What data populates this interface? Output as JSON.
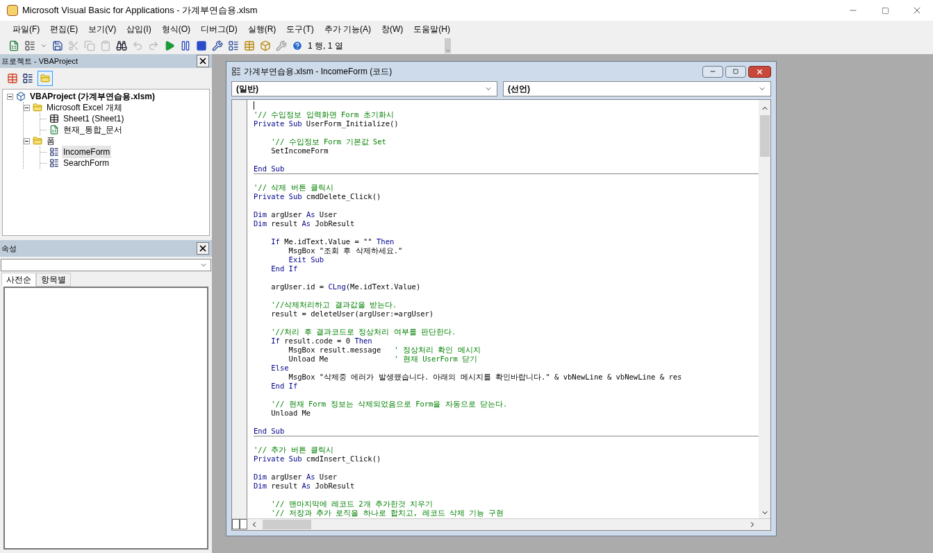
{
  "window": {
    "title": "Microsoft Visual Basic for Applications - 가계부연습용.xlsm"
  },
  "menu": [
    "파일(F)",
    "편집(E)",
    "보기(V)",
    "삽입(I)",
    "형식(O)",
    "디버그(D)",
    "실행(R)",
    "도구(T)",
    "추가 기능(A)",
    "창(W)",
    "도움말(H)"
  ],
  "toolbar": {
    "position": "1 행, 1 열"
  },
  "project_pane": {
    "title": "프로젝트 - VBAProject",
    "tree": [
      {
        "label": "VBAProject (가계부연습용.xlsm)",
        "kind": "project",
        "expanded": true,
        "selected": false,
        "children": [
          {
            "label": "Microsoft Excel 개체",
            "kind": "folder",
            "expanded": true,
            "selected": false,
            "children": [
              {
                "label": "Sheet1 (Sheet1)",
                "kind": "sheet",
                "selected": false
              },
              {
                "label": "현재_통합_문서",
                "kind": "workbook",
                "selected": false
              }
            ]
          },
          {
            "label": "폼",
            "kind": "folder",
            "expanded": true,
            "selected": false,
            "children": [
              {
                "label": "IncomeForm",
                "kind": "form",
                "selected": true
              },
              {
                "label": "SearchForm",
                "kind": "form",
                "selected": false
              }
            ]
          }
        ]
      }
    ]
  },
  "properties_pane": {
    "title": "속성",
    "tabs": [
      {
        "label": "사전순",
        "selected": true
      },
      {
        "label": "항목별",
        "selected": false
      }
    ]
  },
  "code_window": {
    "title": "가계부연습용.xlsm - IncomeForm (코드)",
    "object_combo": "(일반)",
    "procedure_combo": "(선언)",
    "cursor": true,
    "blocks": [
      [
        {
          "segs": [
            {
              "kind": "comment",
              "text": "'// 수입정보 입력화면 Form 초기화시"
            }
          ]
        },
        {
          "segs": [
            {
              "kind": "keyword",
              "text": "Private Sub"
            },
            {
              "kind": "plain",
              "text": " UserForm_Initialize()"
            }
          ],
          "gap_after": true
        },
        {
          "segs": [
            {
              "kind": "comment",
              "text": "    '// 수입정보 Form 기본값 Set"
            }
          ]
        },
        {
          "segs": [
            {
              "kind": "plain",
              "text": "    SetIncomeForm"
            }
          ],
          "gap_after": true
        },
        {
          "segs": [
            {
              "kind": "keyword",
              "text": "End Sub"
            }
          ]
        }
      ],
      [
        {
          "segs": [
            {
              "kind": "comment",
              "text": "'// 삭제 버튼 클릭시"
            }
          ]
        },
        {
          "segs": [
            {
              "kind": "keyword",
              "text": "Private Sub"
            },
            {
              "kind": "plain",
              "text": " cmdDelete_Click()"
            }
          ],
          "gap_after": true
        },
        {
          "segs": [
            {
              "kind": "keyword",
              "text": "Dim"
            },
            {
              "kind": "plain",
              "text": " argUser "
            },
            {
              "kind": "keyword",
              "text": "As"
            },
            {
              "kind": "plain",
              "text": " User"
            }
          ]
        },
        {
          "segs": [
            {
              "kind": "keyword",
              "text": "Dim"
            },
            {
              "kind": "plain",
              "text": " result "
            },
            {
              "kind": "keyword",
              "text": "As"
            },
            {
              "kind": "plain",
              "text": " JobResult"
            }
          ],
          "gap_after": true
        },
        {
          "segs": [
            {
              "kind": "keyword",
              "text": "    If"
            },
            {
              "kind": "plain",
              "text": " Me.idText.Value = \"\" "
            },
            {
              "kind": "keyword",
              "text": "Then"
            }
          ]
        },
        {
          "segs": [
            {
              "kind": "plain",
              "text": "        MsgBox \"조회 후 삭제하세요.\""
            }
          ]
        },
        {
          "segs": [
            {
              "kind": "keyword",
              "text": "        Exit Sub"
            }
          ]
        },
        {
          "segs": [
            {
              "kind": "keyword",
              "text": "    End If"
            }
          ],
          "gap_after": true
        },
        {
          "segs": [
            {
              "kind": "plain",
              "text": "    argUser.id = "
            },
            {
              "kind": "keyword",
              "text": "CLng"
            },
            {
              "kind": "plain",
              "text": "(Me.idText.Value)"
            }
          ],
          "gap_after": true
        },
        {
          "segs": [
            {
              "kind": "comment",
              "text": "    '//삭제처리하고 결과값을 받는다."
            }
          ]
        },
        {
          "segs": [
            {
              "kind": "plain",
              "text": "    result = deleteUser(argUser:=argUser)"
            }
          ],
          "gap_after": true
        },
        {
          "segs": [
            {
              "kind": "comment",
              "text": "    '//처리 후 결과코드로 정상처리 여부를 판단한다."
            }
          ]
        },
        {
          "segs": [
            {
              "kind": "keyword",
              "text": "    If"
            },
            {
              "kind": "plain",
              "text": " result.code = 0 "
            },
            {
              "kind": "keyword",
              "text": "Then"
            }
          ]
        },
        {
          "segs": [
            {
              "kind": "plain",
              "text": "        MsgBox result.message   "
            },
            {
              "kind": "comment",
              "text": "' 정상처리 확인 메시지"
            }
          ]
        },
        {
          "segs": [
            {
              "kind": "plain",
              "text": "        Unload Me               "
            },
            {
              "kind": "comment",
              "text": "' 현재 UserForm 닫기"
            }
          ]
        },
        {
          "segs": [
            {
              "kind": "keyword",
              "text": "    Else"
            }
          ]
        },
        {
          "segs": [
            {
              "kind": "plain",
              "text": "        MsgBox \"삭제중 에러가 발생했습니다. 아래의 메시지를 확인바랍니다.\" & vbNewLine & vbNewLine & res"
            }
          ]
        },
        {
          "segs": [
            {
              "kind": "keyword",
              "text": "    End If"
            }
          ],
          "gap_after": true
        },
        {
          "segs": [
            {
              "kind": "comment",
              "text": "    '// 현재 Form 정보는 삭제되었음으로 Form을 자동으로 닫는다."
            }
          ]
        },
        {
          "segs": [
            {
              "kind": "plain",
              "text": "    Unload Me"
            }
          ],
          "gap_after": true
        },
        {
          "segs": [
            {
              "kind": "keyword",
              "text": "End Sub"
            }
          ]
        }
      ],
      [
        {
          "segs": [
            {
              "kind": "comment",
              "text": "'// 추가 버튼 클릭시"
            }
          ]
        },
        {
          "segs": [
            {
              "kind": "keyword",
              "text": "Private Sub"
            },
            {
              "kind": "plain",
              "text": " cmdInsert_Click()"
            }
          ],
          "gap_after": true
        },
        {
          "segs": [
            {
              "kind": "keyword",
              "text": "Dim"
            },
            {
              "kind": "plain",
              "text": " argUser "
            },
            {
              "kind": "keyword",
              "text": "As"
            },
            {
              "kind": "plain",
              "text": " User"
            }
          ]
        },
        {
          "segs": [
            {
              "kind": "keyword",
              "text": "Dim"
            },
            {
              "kind": "plain",
              "text": " result "
            },
            {
              "kind": "keyword",
              "text": "As"
            },
            {
              "kind": "plain",
              "text": " JobResult"
            }
          ],
          "gap_after": true
        },
        {
          "segs": [
            {
              "kind": "comment",
              "text": "    '// 맨마지막에 레코드 2개 추가한것 지우기"
            }
          ]
        },
        {
          "segs": [
            {
              "kind": "comment",
              "text": "    '// 저장과 추가 로직을 하나로 합치고, 레코드 삭제 기능 구현"
            }
          ]
        }
      ]
    ]
  }
}
